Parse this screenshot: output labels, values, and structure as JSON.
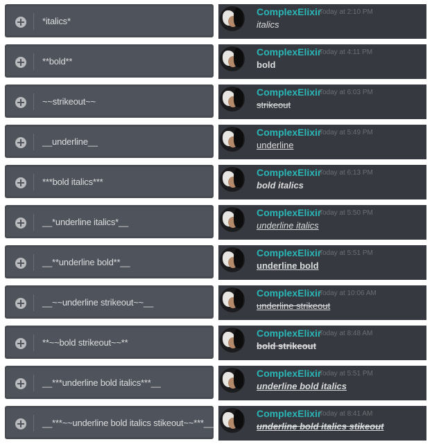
{
  "messages": [
    {
      "input": "*italics*",
      "username": "ComplexElixir",
      "time": "Today at 2:10 PM",
      "text": "italics"
    },
    {
      "input": "**bold**",
      "username": "ComplexElixir",
      "time": "Today at 4:11 PM",
      "text": "bold"
    },
    {
      "input": "~~strikeout~~",
      "username": "ComplexElixir",
      "time": "Today at 6:03 PM",
      "text": "strikeout"
    },
    {
      "input": "__underline__",
      "username": "ComplexElixir",
      "time": "Today at 5:49 PM",
      "text": "underline"
    },
    {
      "input": "***bold italics***",
      "username": "ComplexElixir",
      "time": "Today at 6:13 PM",
      "text": "bold italics"
    },
    {
      "input": "__*underline italics*__",
      "username": "ComplexElixir",
      "time": "Today at 5:50 PM",
      "text": "underline italics"
    },
    {
      "input": "__**underline bold**__",
      "username": "ComplexElixir",
      "time": "Today at 5:51 PM",
      "text": "underline bold"
    },
    {
      "input": "__~~underline strikeout~~__",
      "username": "ComplexElixir",
      "time": "Today at 10:06 AM",
      "text": "underline strikeout"
    },
    {
      "input": "**~~bold strikeout~~**",
      "username": "ComplexElixir",
      "time": "Today at 8:48 AM",
      "text": "bold strikeout"
    },
    {
      "input": "__***underline bold italics***__",
      "username": "ComplexElixir",
      "time": "Today at 5:51 PM",
      "text": "underline bold italics"
    },
    {
      "input": "__***~~underline bold italics stikeout~~***__",
      "username": "ComplexElixir",
      "time": "Today at 8:41 AM",
      "text": "underline bold italics stikeout"
    }
  ],
  "icons": {
    "attach": "plus-circle-icon"
  },
  "colors": {
    "username": "#2ab7b7",
    "message_bg": "#36393f",
    "input_bg": "#4f535b"
  }
}
